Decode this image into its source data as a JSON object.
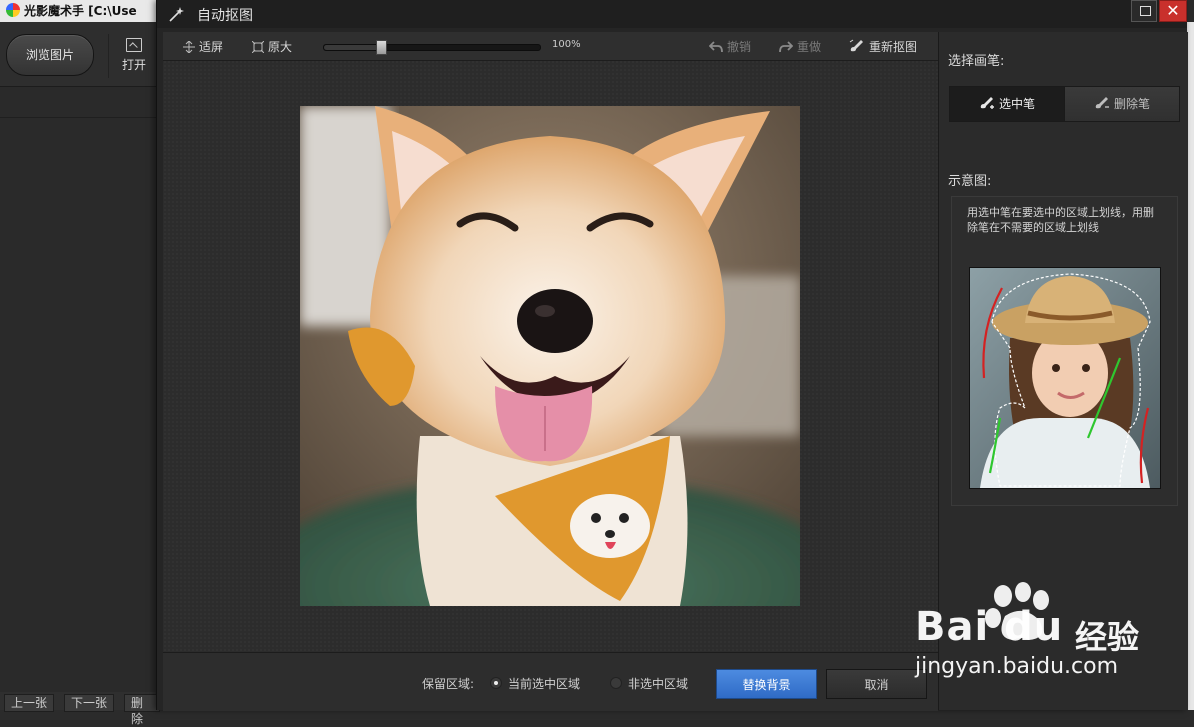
{
  "app": {
    "title": "光影魔术手 [C:\\Use",
    "browse_button": "浏览图片",
    "open_button": "打开",
    "bottom_tabs": [
      "上一张",
      "下一张",
      "删除"
    ]
  },
  "dialog": {
    "title": "自动抠图",
    "close_symbol": "✕",
    "toolbar": {
      "fit_label": "适屏",
      "original_label": "原大",
      "zoom_text": "100%",
      "zoom_value": 0.26,
      "undo_label": "撤销",
      "redo_label": "重做",
      "redo_cutout_label": "重新抠图"
    },
    "bottom": {
      "keep_region_label": "保留区域:",
      "option_selected": "当前选中区域",
      "option_unselected": "非选中区域",
      "replace_bg_button": "替换背景",
      "cancel_button": "取消"
    },
    "panel": {
      "pen_label": "选择画笔:",
      "select_pen": "选中笔",
      "delete_pen": "删除笔",
      "demo_label": "示意图:",
      "demo_text": "用选中笔在要选中的区域上划线，用删除笔在不需要的区域上划线"
    }
  },
  "watermark": {
    "brand": "Bai du",
    "service": "经验",
    "url": "jingyan.baidu.com"
  },
  "colors": {
    "primary_button": "#3a78d4",
    "close_button": "#c9302c",
    "stroke_select": "#2fc72f",
    "stroke_delete": "#d42222"
  }
}
